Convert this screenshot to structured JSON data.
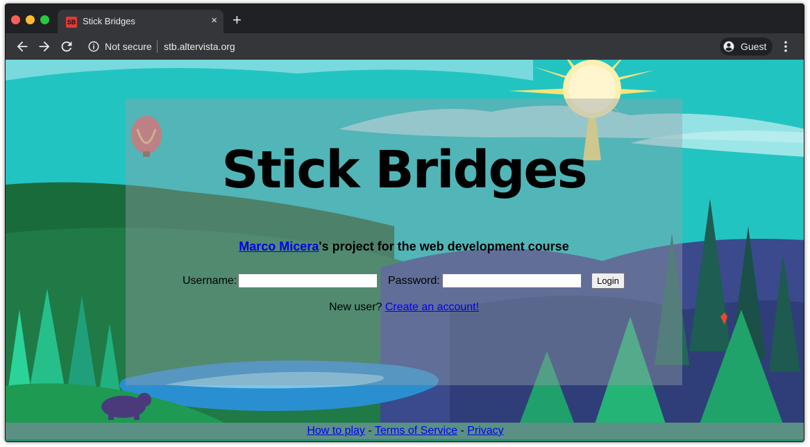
{
  "browser": {
    "tab": {
      "favicon_text": "SB",
      "title": "Stick Bridges",
      "close": "×"
    },
    "new_tab": "+",
    "omnibox": {
      "security": "Not secure",
      "url": "stb.altervista.org"
    },
    "profile": {
      "label": "Guest"
    },
    "icons": [
      "back-arrow-icon",
      "forward-arrow-icon",
      "reload-icon",
      "info-icon",
      "account-circle-icon",
      "kebab-menu-icon"
    ]
  },
  "page": {
    "title": "Stick Bridges",
    "author_link": "Marco Micera",
    "subtitle_rest": "'s project for the web development course",
    "form": {
      "username_label": "Username:",
      "username_value": "",
      "password_label": "Password:",
      "password_value": "",
      "login_button": "Login"
    },
    "signup": {
      "prompt": "New user? ",
      "link": "Create an account!"
    },
    "footer": {
      "how_to_play": "How to play",
      "separator": " - ",
      "terms": "Terms of Service",
      "privacy": "Privacy"
    }
  },
  "colors": {
    "chrome_dark": "#202124",
    "chrome_toolbar": "#35363a",
    "sky": "#22c4c2",
    "link": "#0000ee",
    "favicon": "#e53935"
  }
}
